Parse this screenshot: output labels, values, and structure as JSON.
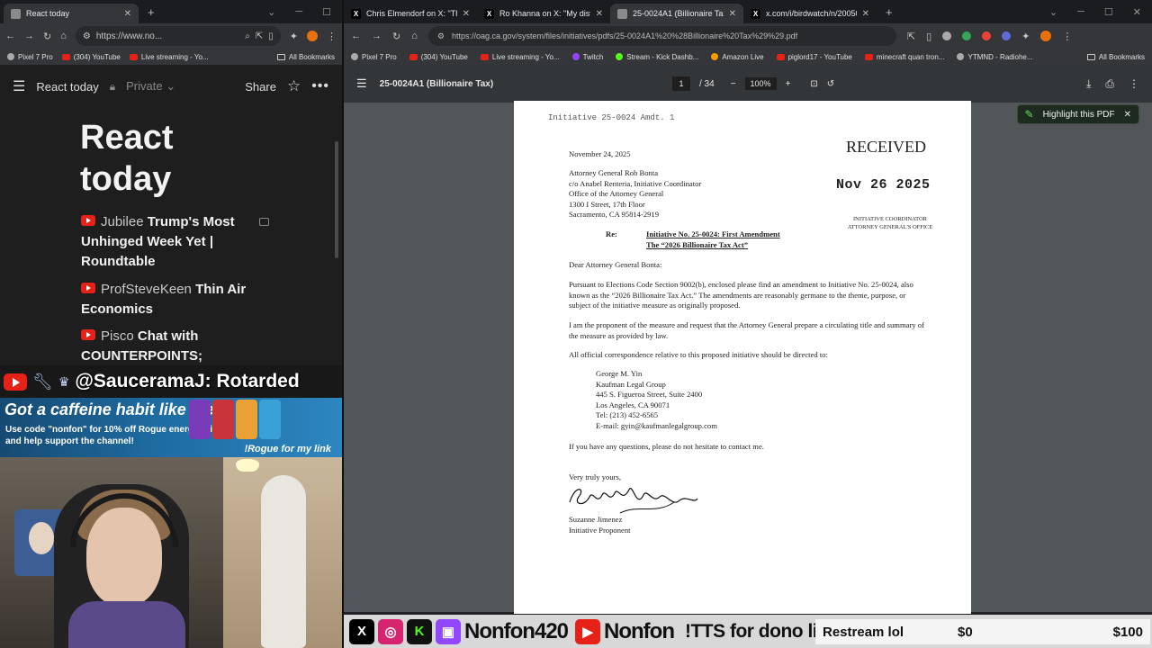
{
  "left_browser": {
    "tab": {
      "title": "React today"
    },
    "url": "https://www.no...",
    "bookmarks": [
      "Pixel 7 Pro",
      "(304) YouTube",
      "Live streaming - Yo...",
      "All Bookmarks"
    ],
    "notes": {
      "title": "React today",
      "privacy": "Private",
      "share_label": "Share",
      "page_title": "React today",
      "items": [
        {
          "source": "Jubilee",
          "title": "Trump's Most Unhinged Week Yet | Roundtable"
        },
        {
          "source": "ProfSteveKeen",
          "title": "Thin Air Economics"
        },
        {
          "source": "Pisco",
          "title": "Chat with COUNTERPOINTS;"
        }
      ]
    }
  },
  "stream_overlay": {
    "chat_message": "@SauceramaJ: Rotarded",
    "sponsor_headline": "Got a caffeine habit like me?",
    "sponsor_sub": "Use code \"nonfon\" for 10% off Rogue energy drinks and help support the channel!",
    "sponsor_link": "!Rogue for my link",
    "can_colors": [
      "#7a3bb8",
      "#c9343a",
      "#e9a035",
      "#3aa1d8"
    ],
    "channel_name_1": "Nonfon420",
    "channel_name_2": "Nonfon",
    "tts_text": "!TTS for dono link",
    "goal_label": "Restream lol",
    "goal_current": "$0",
    "goal_target": "$100"
  },
  "right_browser": {
    "tabs": [
      {
        "title": "Chris Elmendorf on X: \"The go..."
      },
      {
        "title": "Ro Khanna on X: \"My district is..."
      },
      {
        "title": "25-0024A1 (Billionaire Tax)"
      },
      {
        "title": "x.com/i/birdwatch/n/20050135..."
      }
    ],
    "active_tab": 2,
    "url": "https://oag.ca.gov/system/files/initiatives/pdfs/25-0024A1%20%28Billionaire%20Tax%29%29.pdf",
    "bookmarks": [
      "Pixel 7 Pro",
      "(304) YouTube",
      "Live streaming - Yo...",
      "Twitch",
      "Stream - Kick Dashb...",
      "Amazon Live",
      "piglord17 - YouTube",
      "minecraft quan tron...",
      "YTMND - Radiohe...",
      "All Bookmarks"
    ],
    "pdf": {
      "title": "25-0024A1 (Billionaire Tax)",
      "page_current": "1",
      "page_total": "/ 34",
      "zoom": "100%"
    },
    "highlight_popup": "Highlight this PDF"
  },
  "document": {
    "header": "Initiative 25-0024 Amdt. 1",
    "date": "November 24, 2025",
    "address": [
      "Attorney General Rob Bonta",
      "c/o Anabel Renteria, Initiative Coordinator",
      "Office of the Attorney General",
      "1300 I Street, 17th Floor",
      "Sacramento, CA 95814-2919"
    ],
    "stamp_received": "RECEIVED",
    "stamp_date": "Nov 26 2025",
    "stamp_office": [
      "INITIATIVE COORDINATOR",
      "ATTORNEY GENERAL'S OFFICE"
    ],
    "re_label": "Re:",
    "subject": [
      "Initiative No. 25-0024: First Amendment",
      "The “2026 Billionaire Tax Act”"
    ],
    "salutation": "Dear Attorney General Bonta:",
    "para1": "Pursuant to Elections Code Section 9002(b), enclosed please find an amendment to Initiative No. 25-0024, also known as the “2026 Billionaire Tax Act.” The amendments are reasonably germane to the theme, purpose, or subject of the initiative measure as originally proposed.",
    "para2": "I am the proponent of the measure and request that the Attorney General prepare a circulating title and summary of the measure as provided by law.",
    "para3": "All official correspondence relative to this proposed initiative should be directed to:",
    "contact": [
      "George M. Yin",
      "Kaufman Legal Group",
      "445 S. Figueroa Street, Suite 2400",
      "Los Angeles, CA 90071",
      "Tel: (213) 452-6565",
      "E-mail: gyin@kaufmanlegalgroup.com"
    ],
    "para4": "If you have any questions, please do not hesitate to contact me.",
    "closing": "Very truly yours,",
    "signer": "Suzanne Jimenez",
    "signer_title": "Initiative Proponent"
  }
}
